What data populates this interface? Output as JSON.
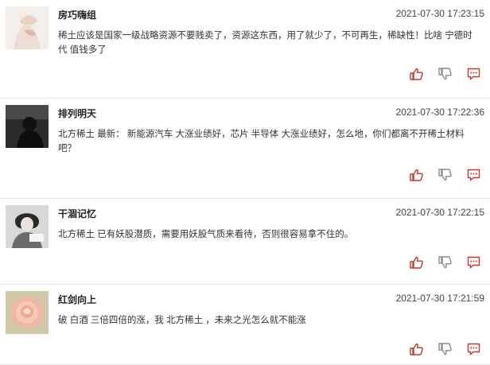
{
  "colors": {
    "icon_red": "#c0392b",
    "icon_gray": "#8a8a8a",
    "divider": "#e8e8e8"
  },
  "posts": [
    {
      "username": "房巧嗨组",
      "time": "2021-07-30 17:23:15",
      "avatar": "neck-hand-photo",
      "content": [
        {
          "text": "稀土应该是国家一级战略资源不要贱卖了，资源这东西，用了就少了，不可再生，稀缺性！比啥 "
        },
        {
          "text": "宁德时代",
          "link": true
        },
        {
          "text": " 值钱多了"
        }
      ]
    },
    {
      "username": "排列明天",
      "time": "2021-07-30 17:22:36",
      "avatar": "silhouette-photo",
      "content": [
        {
          "text": "北方稀土",
          "link": true
        },
        {
          "text": " 最新： 新能源汽车 大涨业绩好，芯片 半导体 大涨业绩好，怎么地，你们都离不开稀土材料吧？"
        }
      ]
    },
    {
      "username": "干涸记忆",
      "time": "2021-07-30 17:22:15",
      "avatar": "person-bw-photo",
      "content": [
        {
          "text": "北方稀土",
          "link": true
        },
        {
          "text": " 已有妖股潜质，需要用妖股气质来看待，否则很容易拿不住的。"
        }
      ]
    },
    {
      "username": "红剑向上",
      "time": "2021-07-30 17:21:59",
      "avatar": "rose-photo",
      "content": [
        {
          "text": "破 "
        },
        {
          "text": "白酒",
          "link": true
        },
        {
          "text": " 三倍四倍的涨，我 "
        },
        {
          "text": "北方稀土",
          "link": true
        },
        {
          "text": " ，未来之光怎么就不能涨"
        }
      ]
    }
  ]
}
